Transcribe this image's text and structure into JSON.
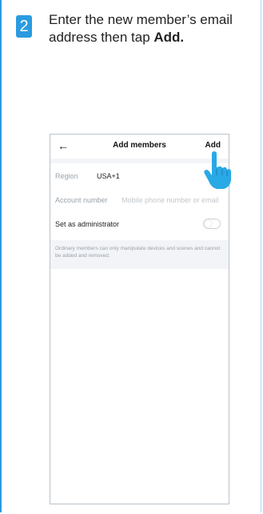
{
  "step": {
    "number": "2"
  },
  "instruction": {
    "text_prefix": "Enter the new member’s email address then tap ",
    "action_word": "Add."
  },
  "screen": {
    "title": "Add members",
    "add_label": "Add",
    "region": {
      "label": "Region",
      "value": "USA+1"
    },
    "account": {
      "label": "Account number",
      "placeholder": "Mobile phone number or email"
    },
    "admin": {
      "label": "Set as administrator"
    },
    "note": "Ordinary members can only manipulate devices and scenes and cannot be added and removed."
  },
  "colors": {
    "accent": "#2b9be0",
    "hand": "#29a9e6"
  },
  "icons": {
    "back": "left-arrow-icon",
    "hand": "pointing-hand-icon",
    "toggle": "toggle-switch-icon"
  }
}
